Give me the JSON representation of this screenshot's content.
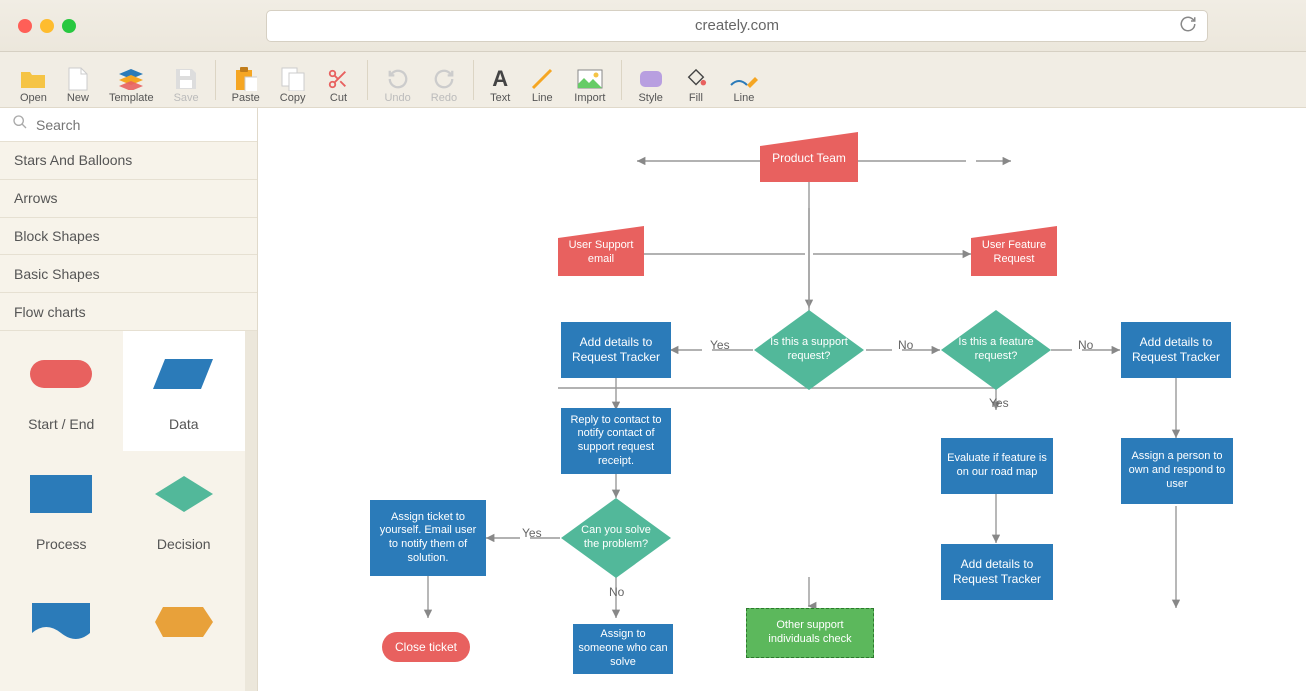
{
  "browser": {
    "url": "creately.com"
  },
  "toolbar": {
    "open": "Open",
    "new": "New",
    "template": "Template",
    "save": "Save",
    "paste": "Paste",
    "copy": "Copy",
    "cut": "Cut",
    "undo": "Undo",
    "redo": "Redo",
    "text": "Text",
    "line": "Line",
    "import": "Import",
    "style": "Style",
    "fill": "Fill",
    "line2": "Line"
  },
  "sidebar": {
    "search_placeholder": "Search",
    "cats": [
      "Stars And Balloons",
      "Arrows",
      "Block Shapes",
      "Basic Shapes",
      "Flow charts"
    ],
    "shapes": {
      "start": "Start / End",
      "data": "Data",
      "process": "Process",
      "decision": "Decision"
    }
  },
  "flow": {
    "productTeam": "Product Team",
    "supportEmail": "User Support email",
    "featureRequest": "User Feature Request",
    "isSupport": "Is this a support request?",
    "isFeature": "Is this a feature request?",
    "addDetails1": "Add details to Request Tracker",
    "addDetails2": "Add details to Request Tracker",
    "reply": "Reply to contact to notify contact of support request receipt.",
    "canSolve": "Can you solve the problem?",
    "assignSelf": "Assign ticket to yourself. Email user to notify them of solution.",
    "evaluate": "Evaluate if feature is on our road map",
    "assignPerson": "Assign a person to own and respond to user",
    "addDetails3": "Add details to Request Tracker",
    "close": "Close ticket",
    "assignOther": "Assign to someone who can solve",
    "otherSupport": "Other support individuals check",
    "yes": "Yes",
    "no": "No"
  }
}
